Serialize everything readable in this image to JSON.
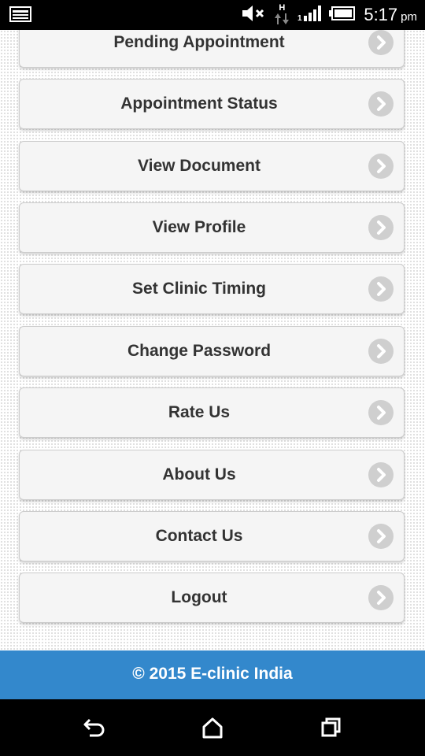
{
  "status_bar": {
    "time": "5:17",
    "ampm": "pm",
    "network_type": "H",
    "icons": [
      "screenshot-icon",
      "mute-icon",
      "data-arrows-icon",
      "signal-icon",
      "battery-icon"
    ]
  },
  "menu": {
    "items": [
      {
        "label": "Pending Appointment"
      },
      {
        "label": "Appointment Status"
      },
      {
        "label": "View Document"
      },
      {
        "label": "View Profile"
      },
      {
        "label": "Set Clinic Timing"
      },
      {
        "label": "Change Password"
      },
      {
        "label": "Rate Us"
      },
      {
        "label": "About Us"
      },
      {
        "label": "Contact Us"
      },
      {
        "label": "Logout"
      }
    ],
    "item_icon": "chevron-right-icon"
  },
  "footer": {
    "text": "© 2015 E-clinic India"
  },
  "colors": {
    "footer_bg": "#3388cc",
    "item_bg": "#f5f5f5",
    "chevron_bg": "#cfcfcf",
    "label_text": "#333333"
  },
  "nav_bar": {
    "icons": [
      "back-icon",
      "home-icon",
      "recent-apps-icon"
    ]
  }
}
